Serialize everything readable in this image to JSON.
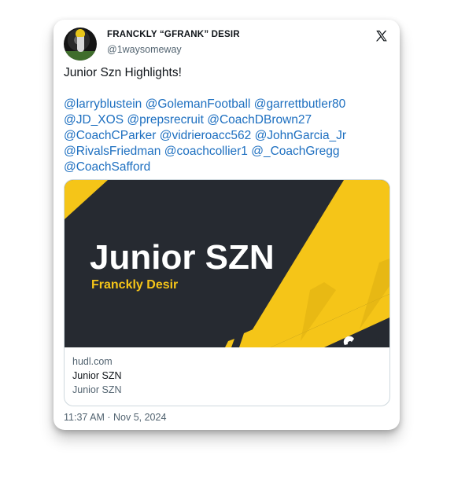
{
  "author": {
    "display_name": "FRANCKLY “GFRANK” DESIR",
    "handle": "@1waysomeway"
  },
  "platform_icon": "x-logo-icon",
  "tweet": {
    "headline": "Junior Szn Highlights!",
    "mentions": [
      "@larryblustein",
      "@GolemanFootball",
      "@garrettbutler80",
      "@JD_XOS",
      "@prepsrecruit",
      "@CoachDBrown27",
      "@CoachCParker",
      "@vidrieroacc562",
      "@JohnGarcia_Jr",
      "@RivalsFriedman",
      "@coachcollier1",
      "@_CoachGregg",
      "@CoachSafford"
    ]
  },
  "link_card": {
    "image": {
      "headline": "Junior SZN",
      "subheadline": "Franckly Desir",
      "brand": "hudl"
    },
    "domain": "hudl.com",
    "title": "Junior SZN",
    "description": "Junior SZN"
  },
  "timestamp": "11:37 AM · Nov 5, 2024",
  "colors": {
    "mention": "#1d6fc0",
    "card_dark": "#262a31",
    "card_yellow": "#f5c518"
  }
}
